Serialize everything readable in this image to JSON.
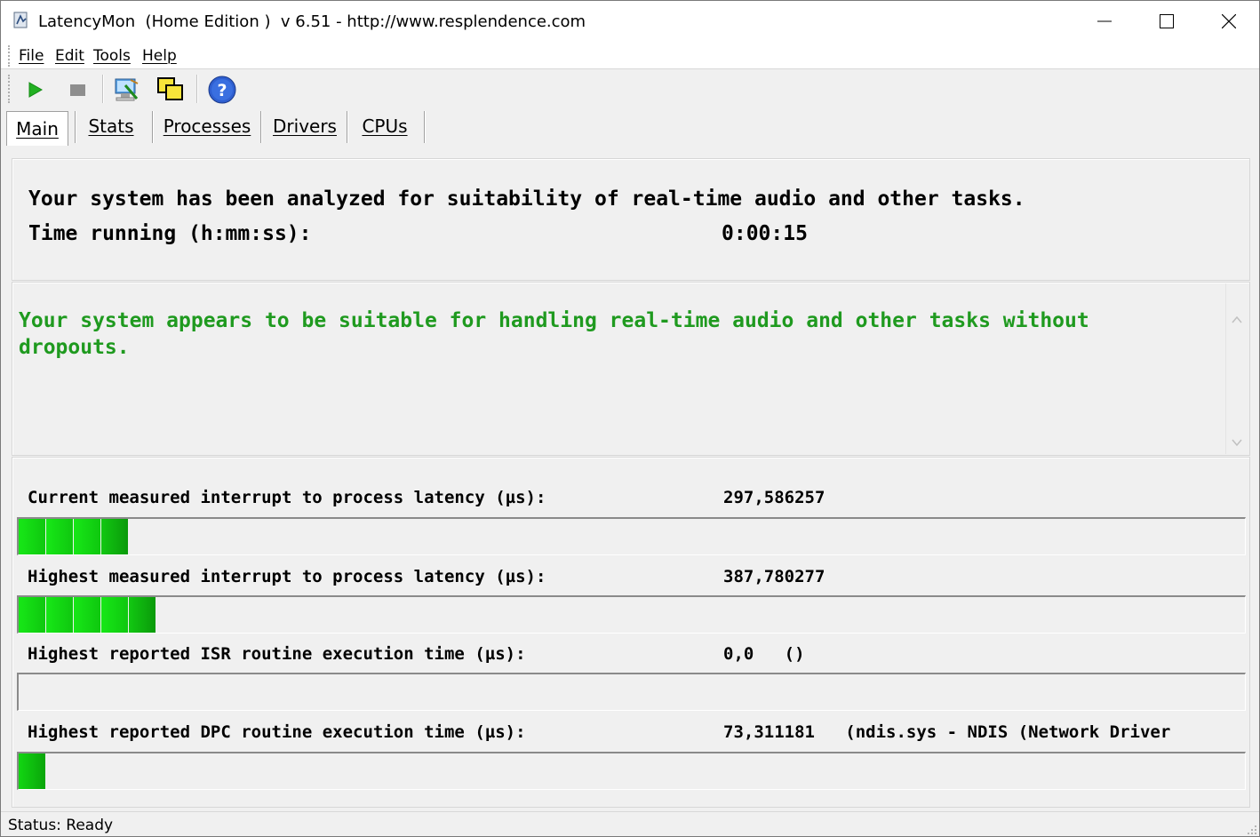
{
  "window": {
    "title": "LatencyMon  (Home Edition )  v 6.51 - http://www.resplendence.com"
  },
  "menu": [
    "File",
    "Edit",
    "Tools",
    "Help"
  ],
  "tabs": [
    "Main",
    "Stats",
    "Processes",
    "Drivers",
    "CPUs"
  ],
  "toolbar": {
    "icons": [
      "play-icon",
      "stop-icon",
      "computer-settings-icon",
      "windows-icon",
      "help-icon"
    ]
  },
  "summary": {
    "analyzed": "Your system has been analyzed for suitability of real-time audio and other tasks.",
    "time_label": "Time running (h:mm:ss):",
    "time_value": "0:00:15"
  },
  "verdict": {
    "text": "Your system appears to be suitable for handling real-time audio and other tasks without dropouts.",
    "color": "#1f9a1f"
  },
  "metrics": [
    {
      "label": "Current measured interrupt to process latency (µs):",
      "value": "297,586257",
      "segments": 4
    },
    {
      "label": "Highest measured interrupt to process latency (µs):",
      "value": "387,780277",
      "segments": 5
    },
    {
      "label": "Highest reported ISR routine execution time (µs):",
      "value": "0,0   ()",
      "segments": 0
    },
    {
      "label": "Highest reported DPC routine execution time (µs):",
      "value": "73,311181   (ndis.sys - NDIS (Network Driver",
      "segments": 1
    }
  ],
  "status": "Status: Ready"
}
